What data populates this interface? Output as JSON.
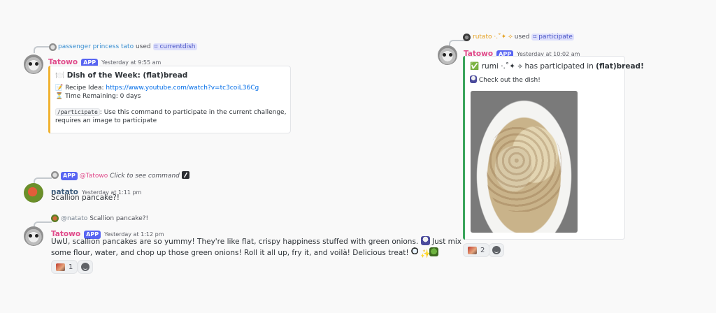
{
  "left": {
    "msg1": {
      "reply_user": "passenger princess tato",
      "reply_used": "used",
      "reply_command": "currentdish",
      "author": "Tatowo",
      "badge": "APP",
      "timestamp": "Yesterday at 9:55 am",
      "embed": {
        "accent": "#f0b232",
        "title_icon": "🍽️",
        "title": "Dish of the Week: (flat)bread",
        "recipe_icon": "📝",
        "recipe_label": "Recipe Idea:",
        "recipe_link": "https://www.youtube.com/watch?v=tc3coiL36Cg",
        "time_icon": "⏳",
        "time_text": "Time Remaining: 0 days",
        "cmd_code": "/participate",
        "cmd_desc_1": ": Use this command to participate in the current challenge,",
        "cmd_desc_2": "requires an image to participate"
      }
    },
    "msg2": {
      "reply_badge": "APP",
      "reply_mention": "@Tatowo",
      "reply_text": "Click to see command",
      "author": "natato",
      "timestamp": "Yesterday at 1:11 pm",
      "text": "Scallion pancake?!"
    },
    "msg3": {
      "reply_mention": "@natato",
      "reply_text": "Scallion pancake?!",
      "author": "Tatowo",
      "badge": "APP",
      "timestamp": "Yesterday at 1:12 pm",
      "line1": "UwU, scallion pancakes are so yummy! They're like flat, crispy happiness stuffed with green onions.",
      "line1_tail": "Just mix",
      "line2": "some flour, water, and chop up those green onions! Roll it all up, fry it, and voilà! Delicious treat!",
      "reaction_count": "1"
    }
  },
  "right": {
    "reply_user": "rutato ·.˚✦ ⟡",
    "reply_used": "used",
    "reply_command": "participate",
    "author": "Tatowo",
    "badge": "APP",
    "timestamp": "Yesterday at 10:02 am",
    "embed": {
      "accent": "#3ba55c",
      "check_icon": "✅",
      "title_prefix": "rumi ·.˚✦ ⟡ has participated in ",
      "title_bold": "(flat)bread",
      "title_suffix": "!",
      "sub_text": "Check out the dish!"
    },
    "reaction_count": "2"
  },
  "colors": {
    "bot_name": "#e04a8a",
    "app_badge": "#5865f2",
    "link": "#006ce7",
    "command_pill_bg": "#dee0fc"
  },
  "icons": {
    "reaction_add": "smiley-add-icon",
    "slash": "slash-command-icon"
  }
}
